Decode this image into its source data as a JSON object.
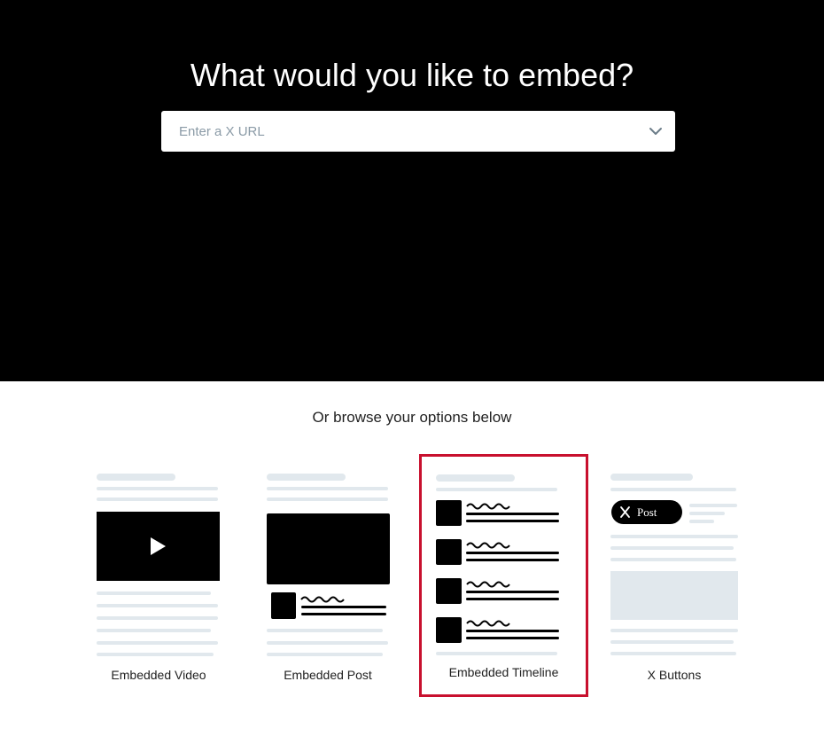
{
  "hero": {
    "title": "What would you like to embed?",
    "url_placeholder": "Enter a X URL"
  },
  "browse": {
    "text": "Or browse your options below"
  },
  "options": [
    {
      "label": "Embedded Video",
      "selected": false
    },
    {
      "label": "Embedded Post",
      "selected": false
    },
    {
      "label": "Embedded Timeline",
      "selected": true
    },
    {
      "label": "X Buttons",
      "selected": false
    }
  ],
  "x_buttons_preview": {
    "pill_label": "Post",
    "pill_icon": "x-logo-icon"
  },
  "colors": {
    "hero_bg": "#000000",
    "placeholder_line": "#e1e8ed",
    "selection_border": "#c8102e"
  }
}
